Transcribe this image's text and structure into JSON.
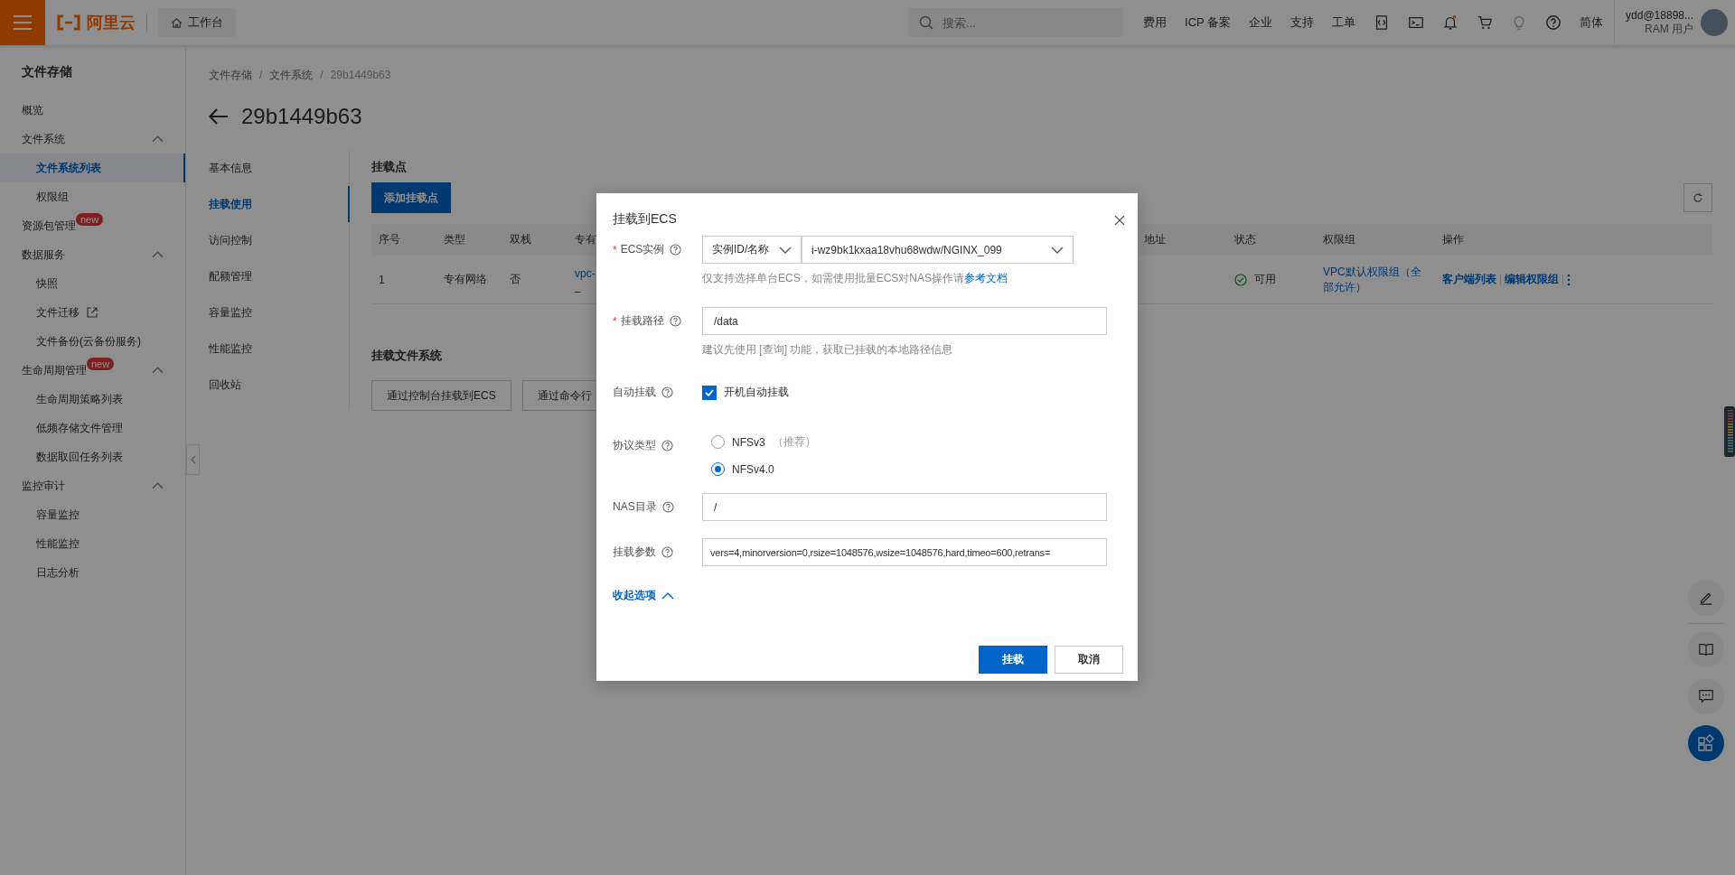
{
  "topbar": {
    "logo": "阿里云",
    "workbench": "工作台",
    "search": {
      "placeholder": "搜索..."
    },
    "nav": [
      "费用",
      "ICP 备案",
      "企业",
      "支持",
      "工单"
    ],
    "notification": true,
    "language": "简体",
    "user": {
      "name": "ydd@18898...",
      "role": "RAM 用户"
    }
  },
  "sidebar": {
    "title": "文件存储",
    "items": [
      {
        "label": "概览",
        "selected": false
      },
      {
        "label": "文件系统",
        "selected": false,
        "expanded": true,
        "children": [
          {
            "label": "文件系统列表",
            "selected": true
          },
          {
            "label": "权限组",
            "selected": false
          }
        ]
      },
      {
        "label": "资源包管理",
        "selected": false,
        "badge": "new"
      },
      {
        "label": "数据服务",
        "selected": false,
        "expanded": true,
        "children": [
          {
            "label": "快照",
            "selected": false
          },
          {
            "label": "文件迁移",
            "selected": false,
            "external": true
          },
          {
            "label": "文件备份(云备份服务)",
            "selected": false
          }
        ]
      },
      {
        "label": "生命周期管理",
        "selected": false,
        "badge": "new",
        "expanded": true,
        "children": [
          {
            "label": "生命周期策略列表",
            "selected": false
          },
          {
            "label": "低频存储文件管理",
            "selected": false
          },
          {
            "label": "数据取回任务列表",
            "selected": false
          }
        ]
      },
      {
        "label": "监控审计",
        "selected": false,
        "expanded": true,
        "children": [
          {
            "label": "容量监控",
            "selected": false
          },
          {
            "label": "性能监控",
            "selected": false
          },
          {
            "label": "日志分析",
            "selected": false
          }
        ]
      }
    ]
  },
  "breadcrumb": {
    "separator": "/",
    "items": [
      "文件存储",
      "文件系统",
      "29b1449b63"
    ]
  },
  "title": "29b1449b63",
  "subnav": [
    {
      "label": "基本信息",
      "selected": false
    },
    {
      "label": "挂载使用",
      "selected": true
    },
    {
      "label": "访问控制",
      "selected": false
    },
    {
      "label": "配额管理",
      "selected": false
    },
    {
      "label": "容量监控",
      "selected": false
    },
    {
      "label": "性能监控",
      "selected": false
    },
    {
      "label": "回收站",
      "selected": false
    }
  ],
  "mount_points": {
    "title": "挂载点",
    "add_button": "添加挂载点",
    "table": {
      "columns": [
        "序号",
        "类型",
        "双栈",
        "专有",
        "地址",
        "状态",
        "权限组",
        "操作"
      ],
      "rows": [
        {
          "index": "1",
          "type": "专有网络",
          "dual_stack": "否",
          "column_4": [
            "vpc-",
            "_"
          ],
          "status": {
            "text": "可用",
            "kind": "ok"
          },
          "permission_group": "VPC默认权限组（全部允许）",
          "actions": [
            "客户端列表",
            "编辑权限组"
          ]
        }
      ]
    }
  },
  "mount_fs": {
    "title": "挂载文件系统",
    "buttons": [
      "通过控制台挂载到ECS",
      "通过命令行"
    ]
  },
  "dialog": {
    "title": "挂载到ECS",
    "required_mark": "*",
    "fields": [
      {
        "kind": "select-pair",
        "label": "ECS实例",
        "required": true,
        "selects": [
          "实例ID/名称",
          "i-wz9bk1kxaa18vhu68wdw/NGINX_099"
        ],
        "hint": "仅支持选择单台ECS，如需使用批量ECS对NAS操作请",
        "hint_link": "参考文档"
      },
      {
        "kind": "input",
        "label": "挂载路径",
        "required": true,
        "value": "/data",
        "hint": "建议先使用 [查询] 功能，获取已挂载的本地路径信息"
      },
      {
        "kind": "checkbox",
        "label": "自动挂载",
        "required": false,
        "text": "开机自动挂载",
        "checked": true
      },
      {
        "kind": "radio",
        "label": "协议类型",
        "required": false,
        "options": [
          {
            "label": "NFSv3",
            "note": "（推荐）",
            "selected": false
          },
          {
            "label": "NFSv4.0",
            "selected": true
          }
        ]
      },
      {
        "kind": "input",
        "label": "NAS目录",
        "required": false,
        "value": "/"
      },
      {
        "kind": "input",
        "label": "挂载参数",
        "required": false,
        "value": "vers=4,minorversion=0,rsize=1048576,wsize=1048576,hard,timeo=600,retrans="
      }
    ],
    "collapse_link": "收起选项",
    "buttons": [
      {
        "label": "挂载",
        "kind": "primary"
      },
      {
        "label": "取消",
        "kind": "default"
      }
    ]
  }
}
